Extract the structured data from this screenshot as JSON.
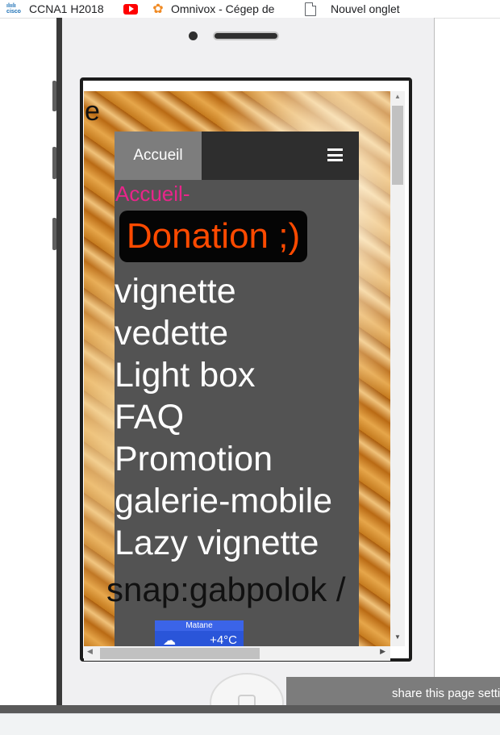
{
  "bookmarks": [
    {
      "label": "CCNA1 H2018",
      "icon": "cisco-icon"
    },
    {
      "label": "",
      "icon": "youtube-icon"
    },
    {
      "label": "Omnivox - Cégep de",
      "icon": "omnivox-flower-icon"
    },
    {
      "label": "Nouvel onglet",
      "icon": "page-icon"
    }
  ],
  "page": {
    "stray_text": "e",
    "navbar": {
      "home_label": "Accueil",
      "menu_icon": "hamburger-icon"
    },
    "breadcrumb": "Accueil-",
    "donation_label": "Donation ;)",
    "menu_items": [
      "vignette",
      "vedette",
      "Light box",
      "FAQ",
      "Promotion",
      "galerie-mobile",
      "Lazy vignette"
    ],
    "snap_text": "snap:gabpolok /",
    "weather": {
      "city": "Matane",
      "temperature": "+4°C",
      "icon": "cloud-snow-icon"
    }
  },
  "share_bar": {
    "label": "share this page setti"
  },
  "colors": {
    "breadcrumb": "#e8258a",
    "donation_text": "#ff4a00",
    "panel": "#535353",
    "navbar": "#2e2e2e"
  }
}
